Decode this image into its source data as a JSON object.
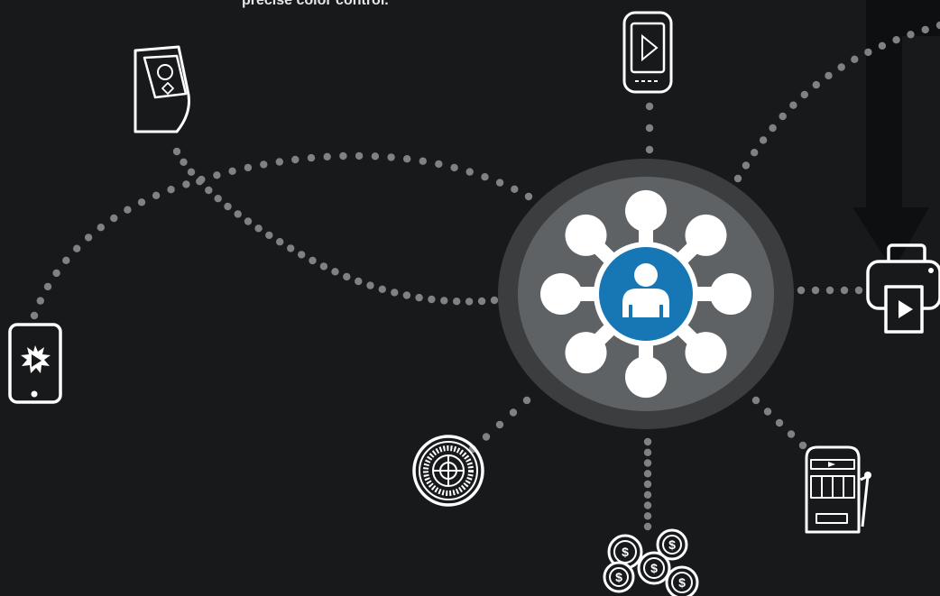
{
  "caption": "precise color control.",
  "colors": {
    "background": "#17191b",
    "outer_ring": "#3b3d3f",
    "inner_disc": "#5f6264",
    "hub": "#1777b5",
    "node_white": "#ffffff",
    "dots": "#7f8183",
    "icon_stroke": "#ffffff"
  },
  "hub": {
    "icon": "person-icon",
    "satellite_count": 8
  },
  "devices": [
    {
      "name": "kiosk-icon",
      "description": "self-service kiosk"
    },
    {
      "name": "smartphone-icon",
      "description": "mobile phone with play button"
    },
    {
      "name": "printer-icon",
      "description": "ticket printer"
    },
    {
      "name": "tablet-icon",
      "description": "tablet with burst logo"
    },
    {
      "name": "roulette-wheel-icon",
      "description": "roulette wheel"
    },
    {
      "name": "casino-chips-icon",
      "description": "stack of dollar chips"
    },
    {
      "name": "slot-machine-icon",
      "description": "slot machine"
    }
  ],
  "chip_symbol": "$"
}
